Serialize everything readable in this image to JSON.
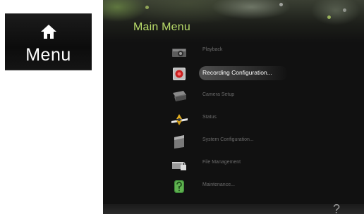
{
  "tile": {
    "label": "Menu",
    "icon": "home-icon"
  },
  "window": {
    "title": "Main Menu",
    "items": [
      {
        "label": "Playback",
        "icon": "camera-icon",
        "selected": false
      },
      {
        "label": "Recording Configuration...",
        "icon": "record-icon",
        "selected": true
      },
      {
        "label": "Camera Setup",
        "icon": "camera-setup-icon",
        "selected": false
      },
      {
        "label": "Status",
        "icon": "status-icon",
        "selected": false
      },
      {
        "label": "System Configuration...",
        "icon": "system-config-icon",
        "selected": false
      },
      {
        "label": "File Management",
        "icon": "file-management-icon",
        "selected": false
      },
      {
        "label": "Maintenance...",
        "icon": "maintenance-icon",
        "selected": false
      }
    ],
    "help_icon": "help-icon"
  },
  "colors": {
    "title": "#b9dc6a",
    "background": "#111111",
    "label_dim": "#6c6c6c",
    "label_active": "#ffffff"
  }
}
